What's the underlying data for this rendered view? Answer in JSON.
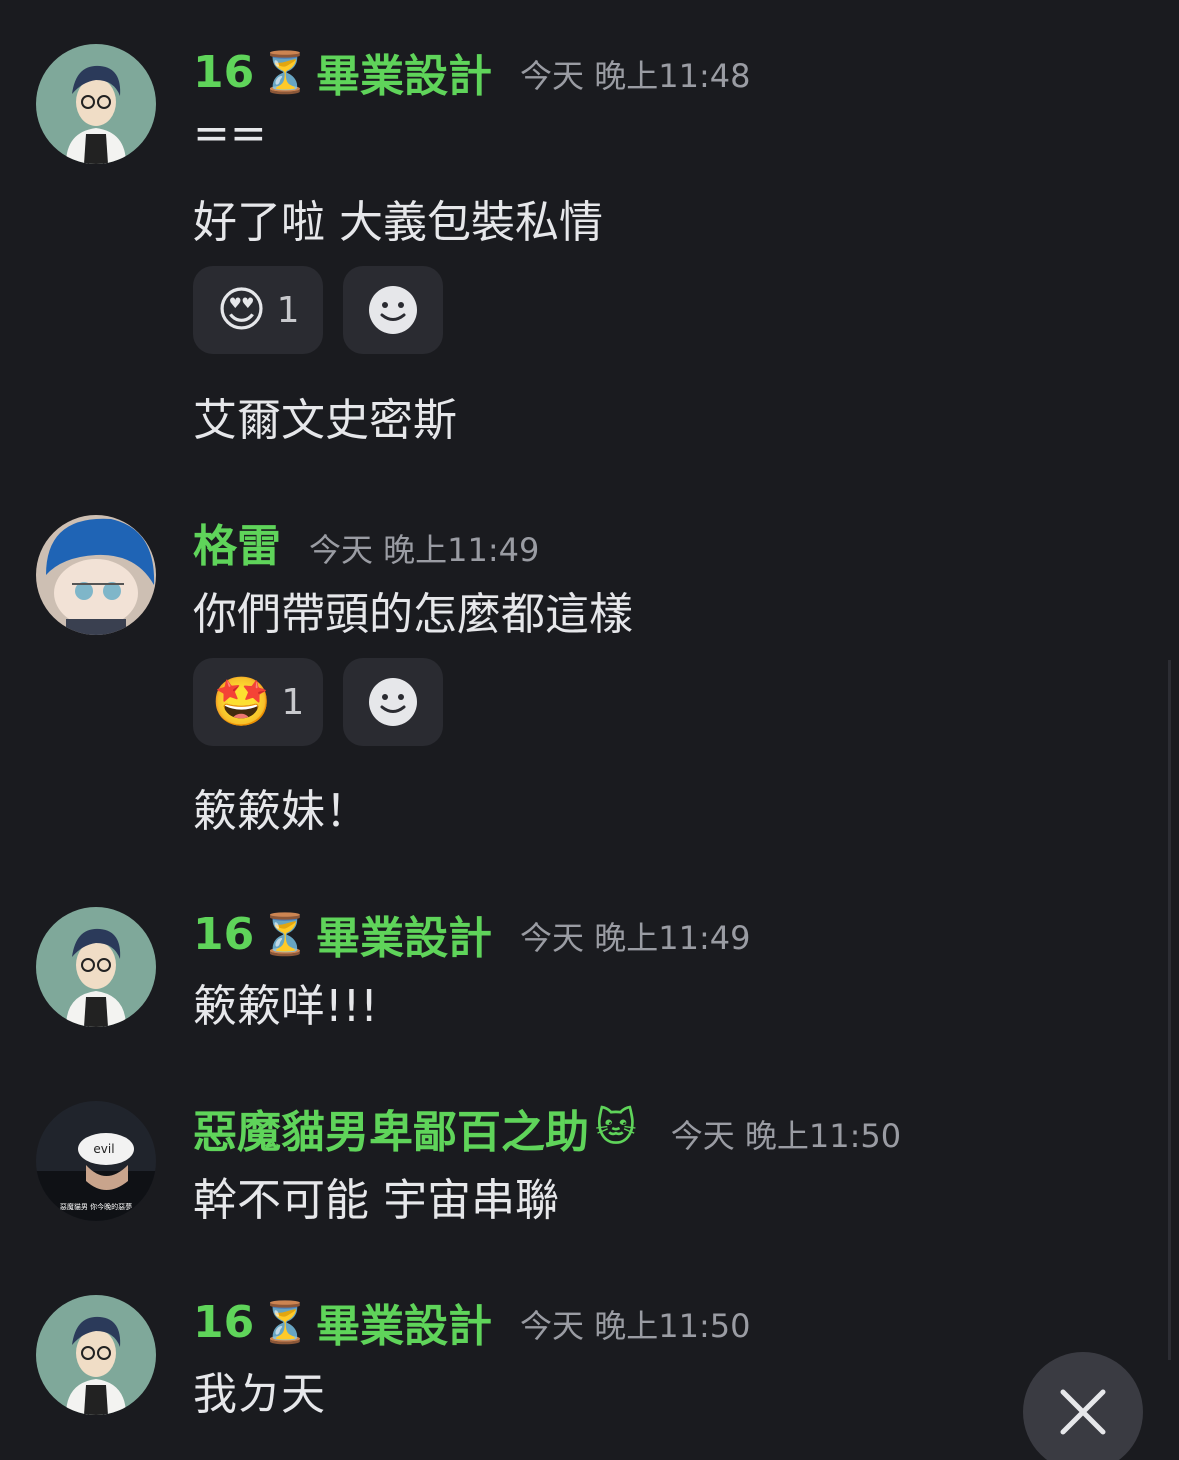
{
  "colors": {
    "background": "#1a1b1f",
    "username": "#5fd45a",
    "timestamp": "#9a9ca3",
    "chip": "#2a2b31"
  },
  "groups": [
    {
      "user": {
        "name_prefix": "16",
        "name_icon": "hourglass-icon",
        "name_suffix": "畢業設計",
        "timestamp": "今天 晚上11:48"
      },
      "lines": [
        "==",
        "好了啦 大義包裝私情",
        "艾爾文史密斯"
      ],
      "reaction": {
        "emoji": "😍",
        "count": "1"
      }
    },
    {
      "user": {
        "name": "格雷",
        "timestamp": "今天 晚上11:49"
      },
      "lines": [
        "你們帶頭的怎麼都這樣",
        "簌簌妹！"
      ],
      "reaction": {
        "emoji": "🤩",
        "count": "1"
      }
    },
    {
      "user": {
        "name_prefix": "16",
        "name_icon": "hourglass-icon",
        "name_suffix": "畢業設計",
        "timestamp": "今天 晚上11:49"
      },
      "lines": [
        "簌簌咩!!!"
      ]
    },
    {
      "user": {
        "name": "惡魔貓男卑鄙百之助",
        "name_icon": "cat-face-icon",
        "timestamp": "今天 晚上11:50",
        "avatar_caption": "惡魔貓男 你今晚的惡夢",
        "avatar_mask_text": "evil"
      },
      "lines": [
        "幹不可能 宇宙串聯"
      ]
    },
    {
      "user": {
        "name_prefix": "16",
        "name_icon": "hourglass-icon",
        "name_suffix": "畢業設計",
        "timestamp": "今天 晚上11:50"
      },
      "lines": [
        "我ㄉ天"
      ]
    }
  ]
}
